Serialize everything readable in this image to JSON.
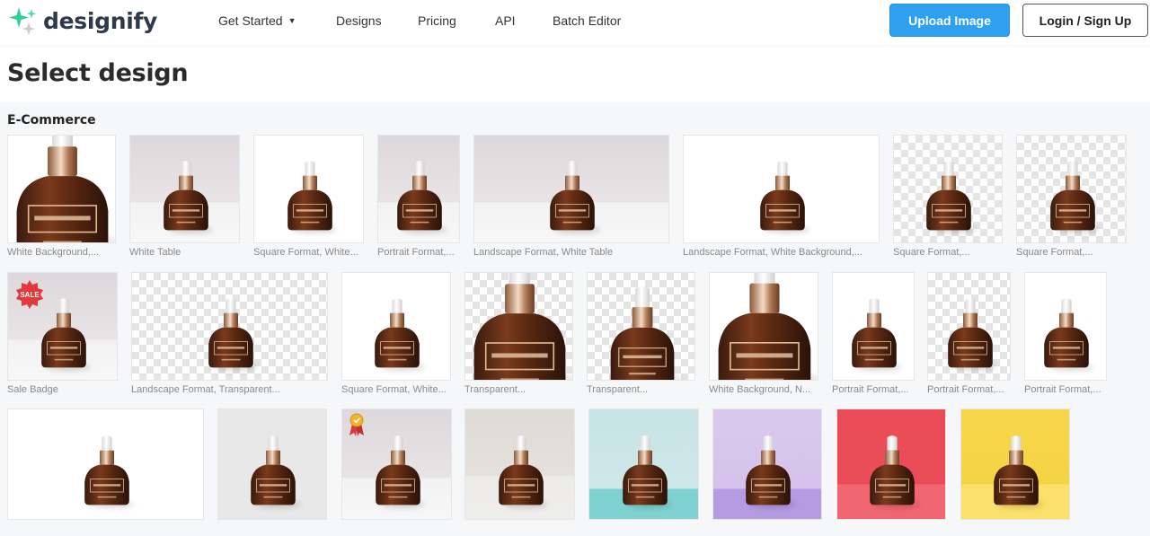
{
  "header": {
    "logo_text": "designify",
    "nav": [
      {
        "label": "Get Started",
        "has_dropdown": true
      },
      {
        "label": "Designs"
      },
      {
        "label": "Pricing"
      },
      {
        "label": "API"
      },
      {
        "label": "Batch Editor"
      }
    ],
    "upload_button": "Upload Image",
    "login_button": "Login / Sign Up"
  },
  "page": {
    "title": "Select design",
    "section_title": "E-Commerce"
  },
  "designs": [
    {
      "label": "White Background,...",
      "background": "white",
      "zoom": "close"
    },
    {
      "label": "White Table",
      "background": "table"
    },
    {
      "label": "Square Format, White...",
      "background": "white"
    },
    {
      "label": "Portrait Format,...",
      "background": "table"
    },
    {
      "label": "Landscape Format, White Table",
      "background": "table"
    },
    {
      "label": "Landscape Format, White Background,...",
      "background": "white"
    },
    {
      "label": "Square Format,...",
      "background": "transparent"
    },
    {
      "label": "Square Format,...",
      "background": "transparent"
    },
    {
      "label": "Sale Badge",
      "background": "table",
      "badge": "SALE"
    },
    {
      "label": "Landscape Format, Transparent...",
      "background": "transparent"
    },
    {
      "label": "Square Format, White...",
      "background": "white"
    },
    {
      "label": "Transparent...",
      "background": "transparent",
      "zoom": "close"
    },
    {
      "label": "Transparent...",
      "background": "transparent",
      "zoom": "medium"
    },
    {
      "label": "White Background, N...",
      "background": "white",
      "zoom": "close"
    },
    {
      "label": "Portrait Format,...",
      "background": "white"
    },
    {
      "label": "Portrait Format,...",
      "background": "transparent"
    },
    {
      "label": "Portrait Format,...",
      "background": "white"
    },
    {
      "label": "",
      "background": "white"
    },
    {
      "label": "",
      "background": "grey"
    },
    {
      "label": "",
      "background": "table",
      "icon": "award-ribbon-icon"
    },
    {
      "label": "",
      "background": "beige"
    },
    {
      "label": "",
      "background": "teal"
    },
    {
      "label": "",
      "background": "lilac"
    },
    {
      "label": "",
      "background": "red"
    },
    {
      "label": "",
      "background": "yellow"
    }
  ],
  "colors": {
    "brand_text": "#2d3a4b",
    "upload_button": "#2fa0f0",
    "sale_badge": "#e23a3a"
  }
}
